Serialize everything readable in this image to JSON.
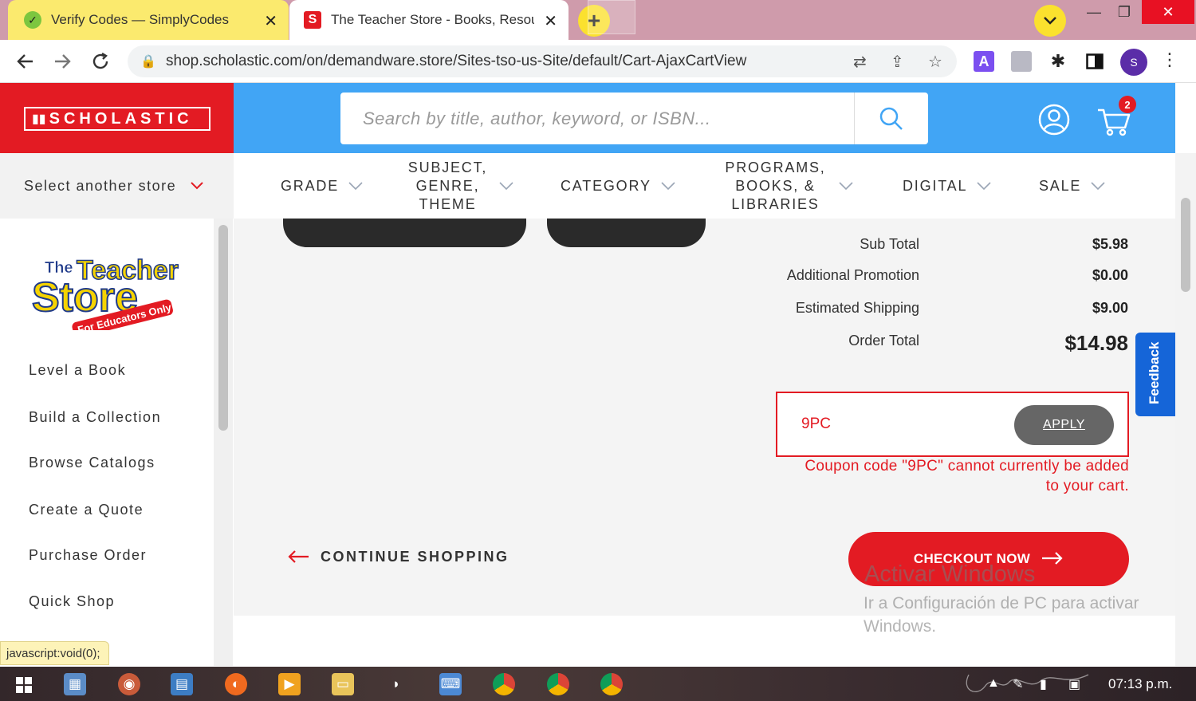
{
  "browser": {
    "tabs": [
      {
        "title": "Verify Codes — SimplyCodes",
        "favicon": "check-leaf-icon",
        "close": "✕"
      },
      {
        "title": "The Teacher Store - Books, Resou",
        "favicon": "scholastic-s-icon",
        "close": "✕"
      }
    ],
    "new_tab": "+",
    "url": "shop.scholastic.com/on/demandware.store/Sites-tso-us-Site/default/Cart-AjaxCartView",
    "profile_initial": "S",
    "extension_a": "A"
  },
  "site": {
    "brand": "SCHOLASTIC",
    "search_placeholder": "Search by title, author, keyword, or ISBN...",
    "cart_count": "2",
    "store_select": "Select another store",
    "nav": [
      {
        "label": "GRADE"
      },
      {
        "label": "SUBJECT, GENRE, THEME"
      },
      {
        "label": "CATEGORY"
      },
      {
        "label": "PROGRAMS, BOOKS, & LIBRARIES"
      },
      {
        "label": "DIGITAL"
      },
      {
        "label": "SALE"
      }
    ],
    "teacher_store_logo": {
      "line1": "The",
      "line2": "Teacher",
      "line3": "Store",
      "tagline": "For Educators Only"
    },
    "sidebar_links": [
      "Level a Book",
      "Build a Collection",
      "Browse Catalogs",
      "Create a Quote",
      "Purchase Order",
      "Quick Shop"
    ]
  },
  "summary": {
    "rows": [
      {
        "label": "Sub Total",
        "value": "$5.98"
      },
      {
        "label": "Additional Promotion",
        "value": "$0.00"
      },
      {
        "label": "Estimated Shipping",
        "value": "$9.00"
      },
      {
        "label": "Order Total",
        "value": "$14.98"
      }
    ]
  },
  "coupon": {
    "value": "9PC",
    "apply_label": "APPLY",
    "error_line1": "Coupon code \"9PC\" cannot currently be added",
    "error_line2": "to your cart."
  },
  "continue_label": "CONTINUE SHOPPING",
  "checkout_label": "CHECKOUT NOW",
  "feedback_label": "Feedback",
  "watermark": {
    "title": "Activar Windows",
    "subtitle": "Ir a Configuración de PC para activar Windows."
  },
  "status_bar": "javascript:void(0);",
  "taskbar": {
    "clock": "07:13 p.m."
  },
  "colors": {
    "scholastic_red": "#e31b23",
    "header_blue": "#41a5f5",
    "feedback_blue": "#1565d8"
  }
}
